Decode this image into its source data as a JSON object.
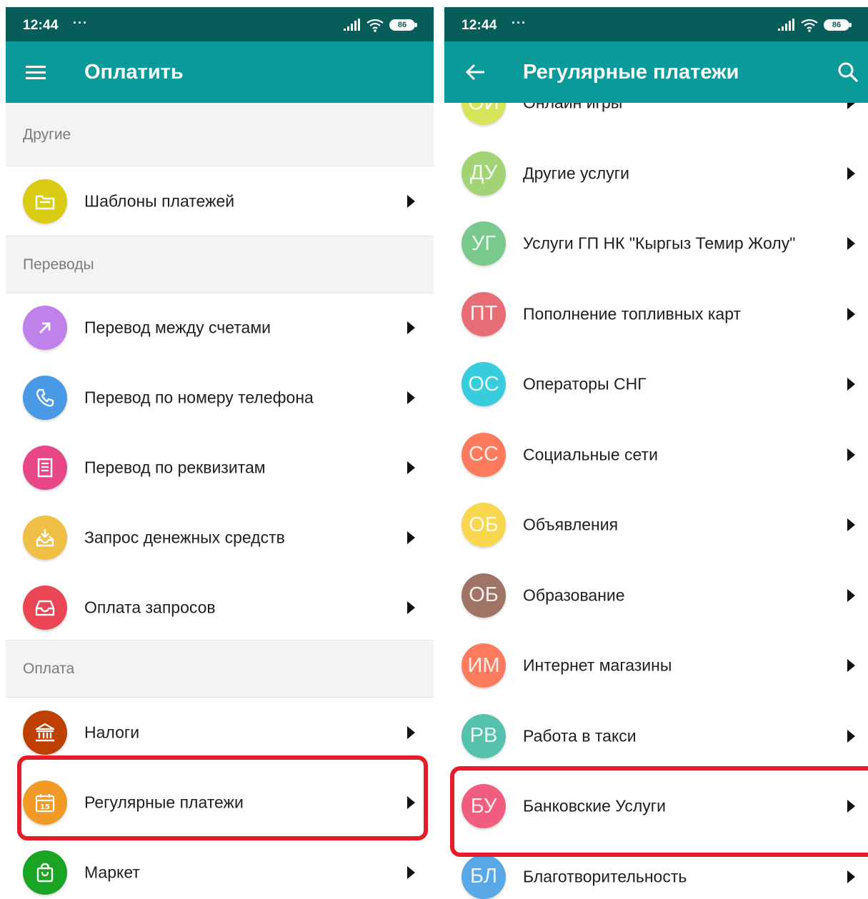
{
  "colors": {
    "status_bar": "#075d57",
    "app_bar": "#0b9a9a",
    "highlight": "#e51d2a",
    "section_bg": "#f3f3f3",
    "section_text": "#7b7b7b"
  },
  "left": {
    "status": {
      "time": "12:44",
      "dots": "···",
      "battery": "86",
      "icons": [
        "signal-icon",
        "wifi-icon",
        "battery-icon"
      ]
    },
    "header": {
      "title": "Оплатить",
      "nav_icon": "menu-icon"
    },
    "sections": [
      {
        "title": "Другие",
        "items": [
          {
            "label": "Шаблоны платежей",
            "icon": "folder-icon",
            "color": "#d9cc13"
          }
        ]
      },
      {
        "title": "Переводы",
        "items": [
          {
            "label": "Перевод между счетами",
            "icon": "arrow-up-right-icon",
            "color": "#bf81ea"
          },
          {
            "label": "Перевод по номеру телефона",
            "icon": "phone-icon",
            "color": "#4a99e6"
          },
          {
            "label": "Перевод по реквизитам",
            "icon": "document-icon",
            "color": "#e74687"
          },
          {
            "label": "Запрос денежных средств",
            "icon": "inbox-download-icon",
            "color": "#f0bf45"
          },
          {
            "label": "Оплата запросов",
            "icon": "tray-icon",
            "color": "#ec4655"
          }
        ]
      },
      {
        "title": "Оплата",
        "items": [
          {
            "label": "Налоги",
            "icon": "bank-icon",
            "color": "#be4000",
            "highlighted": false
          },
          {
            "label": "Регулярные платежи",
            "icon": "calendar-icon",
            "color": "#f29a26",
            "badge": "15",
            "highlighted": true
          },
          {
            "label": "Маркет",
            "icon": "shopping-bag-icon",
            "color": "#19a424",
            "highlighted": false
          }
        ]
      }
    ]
  },
  "right": {
    "status": {
      "time": "12:44",
      "dots": "···",
      "battery": "86",
      "icons": [
        "signal-icon",
        "wifi-icon",
        "battery-icon"
      ]
    },
    "header": {
      "title": "Регулярные платежи",
      "nav_icon": "back-arrow-icon",
      "action_icon": "search-icon"
    },
    "items": [
      {
        "abbr": "ОИ",
        "label": "Онлайн игры",
        "color": "#d6e45a",
        "highlighted": false
      },
      {
        "abbr": "ДУ",
        "label": "Другие услуги",
        "color": "#a2d475",
        "highlighted": false
      },
      {
        "abbr": "УГ",
        "label": "Услуги ГП НК \"Кыргыз Темир Жолу\"",
        "color": "#79c98d",
        "highlighted": false
      },
      {
        "abbr": "ПТ",
        "label": "Пополнение топливных карт",
        "color": "#e96d76",
        "highlighted": false
      },
      {
        "abbr": "ОС",
        "label": "Операторы СНГ",
        "color": "#38cddd",
        "highlighted": false
      },
      {
        "abbr": "СС",
        "label": "Социальные сети",
        "color": "#ff7a5c",
        "highlighted": false
      },
      {
        "abbr": "ОБ",
        "label": "Объявления",
        "color": "#f8d64e",
        "highlighted": false
      },
      {
        "abbr": "ОБ",
        "label": "Образование",
        "color": "#9f7467",
        "highlighted": false
      },
      {
        "abbr": "ИМ",
        "label": "Интернет магазины",
        "color": "#ff7b5e",
        "highlighted": false
      },
      {
        "abbr": "РВ",
        "label": "Работа в такси",
        "color": "#56c1ad",
        "highlighted": false
      },
      {
        "abbr": "БУ",
        "label": "Банковские Услуги",
        "color": "#f05d7d",
        "highlighted": true
      },
      {
        "abbr": "БЛ",
        "label": "Благотворительность",
        "color": "#58a8e7",
        "highlighted": false
      }
    ]
  }
}
